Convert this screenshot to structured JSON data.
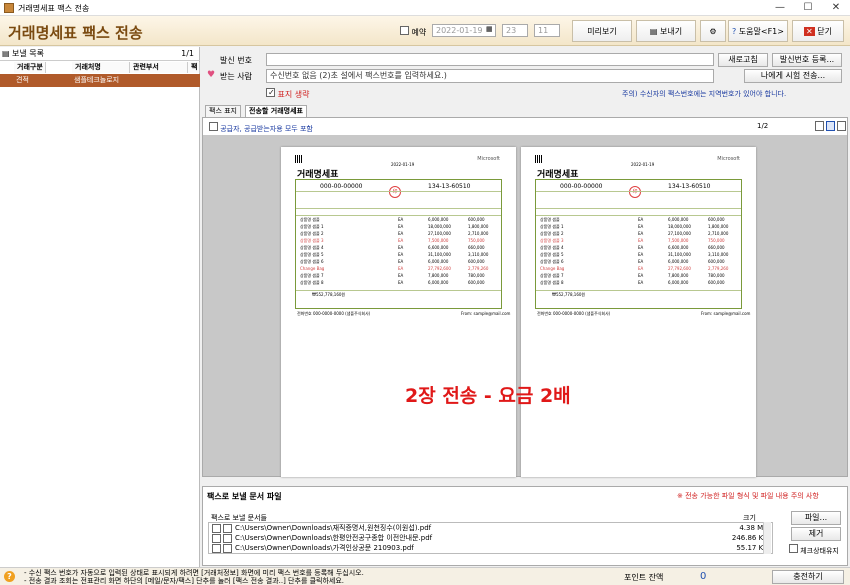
{
  "window": {
    "title": "거래명세표 팩스 전송"
  },
  "toolbar": {
    "app_title": "거래명세표 팩스 전송",
    "reserve_label": "예약",
    "date_value": "2022-01-19",
    "hour_value": "23",
    "minute_value": "11",
    "preview_label": "미리보기",
    "send_label": "보내기",
    "help_label": "도움말<F1>",
    "close_label": "닫기"
  },
  "left_panel": {
    "header": "보낼 목록",
    "count": "1/1",
    "columns": [
      "거래구분",
      "거래처명",
      "관련부서",
      "팩"
    ],
    "rows": [
      {
        "type": "견적",
        "name": "샘플테크놀로지",
        "dept": "",
        "fax": ""
      }
    ]
  },
  "sender": {
    "label": "발신 번호",
    "refresh_label": "새로고침",
    "register_label": "발신번호 등록..."
  },
  "receiver": {
    "label": "받는 사람",
    "placeholder": "수신번호 없음 (2)초 설에서 팩스번호를 입력하세요.)",
    "test_label": "나에게 시험 전송...",
    "cover_label": "표지 생략",
    "notice": "주의) 수신자의 팩스번호에는 지역번호가 있어야 합니다."
  },
  "tabs": [
    {
      "label": "팩스 표지"
    },
    {
      "label": "전송할 거래명세표"
    }
  ],
  "preview": {
    "include_label": "공급자, 공급받는자용 모두 포함",
    "page_indicator": "1/2",
    "big_message": "2장 전송 - 요금 2배",
    "invoice": {
      "title": "거래명세표",
      "brand": "Microsoft",
      "phone": "000-00-00000",
      "reg_no": "134-13-60510",
      "date": "2022-01-19",
      "total": "₩552,778,160원",
      "footer": "전화번호 000-0000-0000 (샘플주식회사)",
      "email": "From: sample@mail.com",
      "items": [
        {
          "name": "상품명 샘플",
          "qty": "EA",
          "price": "6,000,000",
          "amount": "600,000"
        },
        {
          "name": "상품명 샘플 1",
          "qty": "EA",
          "price": "18,000,000",
          "amount": "1,800,000"
        },
        {
          "name": "상품명 샘플 2",
          "qty": "EA",
          "price": "27,100,000",
          "amount": "2,710,000"
        },
        {
          "name": "상품명 샘플 3",
          "qty": "EA",
          "price": "7,500,000",
          "amount": "750,000"
        },
        {
          "name": "상품명 샘플 4",
          "qty": "EA",
          "price": "6,600,000",
          "amount": "660,000"
        },
        {
          "name": "상품명 샘플 5",
          "qty": "EA",
          "price": "31,100,000",
          "amount": "3,110,000"
        },
        {
          "name": "상품명 샘플 6",
          "qty": "EA",
          "price": "6,000,000",
          "amount": "600,000"
        },
        {
          "name": "Change Bag",
          "qty": "EA",
          "price": "27,792,600",
          "amount": "2,779,260"
        },
        {
          "name": "상품명 샘플 7",
          "qty": "EA",
          "price": "7,800,000",
          "amount": "780,000"
        },
        {
          "name": "상품명 샘플 8",
          "qty": "EA",
          "price": "6,000,000",
          "amount": "600,000"
        }
      ]
    }
  },
  "files": {
    "section_title": "팩스로 보낼 문서 파일",
    "warning": "※ 전송 가능한 파일 형식 및 파일 내용 주의 사항",
    "list_header": "팩스로 보낼 문서들",
    "size_header": "크기",
    "items": [
      {
        "path": "C:\\Users\\Owner\\Downloads\\재직증명서,원천징수(이원섭).pdf",
        "size": "4.38 MB"
      },
      {
        "path": "C:\\Users\\Owner\\Downloads\\한평안전공구종합 이전안내문.pdf",
        "size": "246.86 KB"
      },
      {
        "path": "C:\\Users\\Owner\\Downloads\\가격인상공문 210903.pdf",
        "size": "55.17 KB"
      }
    ],
    "file_button": "파일...",
    "remove_button": "제거",
    "keep_label": "체크상태유지"
  },
  "status": {
    "line1": "- 수신 팩스 번호가 자동으로 입력된 상태로 표시되게 하려면 [거래처정보] 화면에 미리 팩스 번호를 등록해 두십시오.",
    "line2": "- 전송 결과 조회는 전표관리 화면 하단의 [메일/문자/팩스] 단추를 눌러 [팩스 전송 결과..] 단추를 클릭하세요.",
    "points_label": "포인트 잔액",
    "points_value": "0",
    "charge_label": "충전하기"
  },
  "colors": {
    "brand": "#7a4a10",
    "selection": "#b05a2a",
    "accent_red": "#e01818",
    "notice_blue": "#1a3aa0"
  }
}
